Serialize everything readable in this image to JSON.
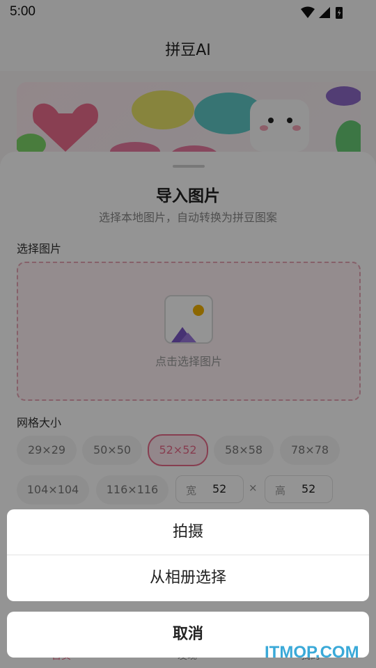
{
  "status_bar": {
    "time": "5:00"
  },
  "app_bar": {
    "title": "拼豆AI"
  },
  "sheet": {
    "title": "导入图片",
    "subtitle": "选择本地图片，自动转换为拼豆图案",
    "select_image_label": "选择图片",
    "upload_hint": "点击选择图片",
    "grid_size_label": "网格大小",
    "grid_options": [
      "29×29",
      "50×50",
      "52×52",
      "58×58",
      "78×78",
      "104×104",
      "116×116"
    ],
    "selected_grid": "52×52",
    "custom": {
      "width_label": "宽",
      "width_value": "52",
      "times": "×",
      "height_label": "高",
      "height_value": "52"
    }
  },
  "action_sheet": {
    "options": [
      "拍摄",
      "从相册选择"
    ],
    "cancel": "取消"
  },
  "tabs": [
    "首页",
    "发现",
    "我的"
  ],
  "watermark": "ITMOP.COM",
  "colors": {
    "accent": "#e86b8b",
    "dim_overlay": "rgba(0,0,0,0.42)"
  }
}
